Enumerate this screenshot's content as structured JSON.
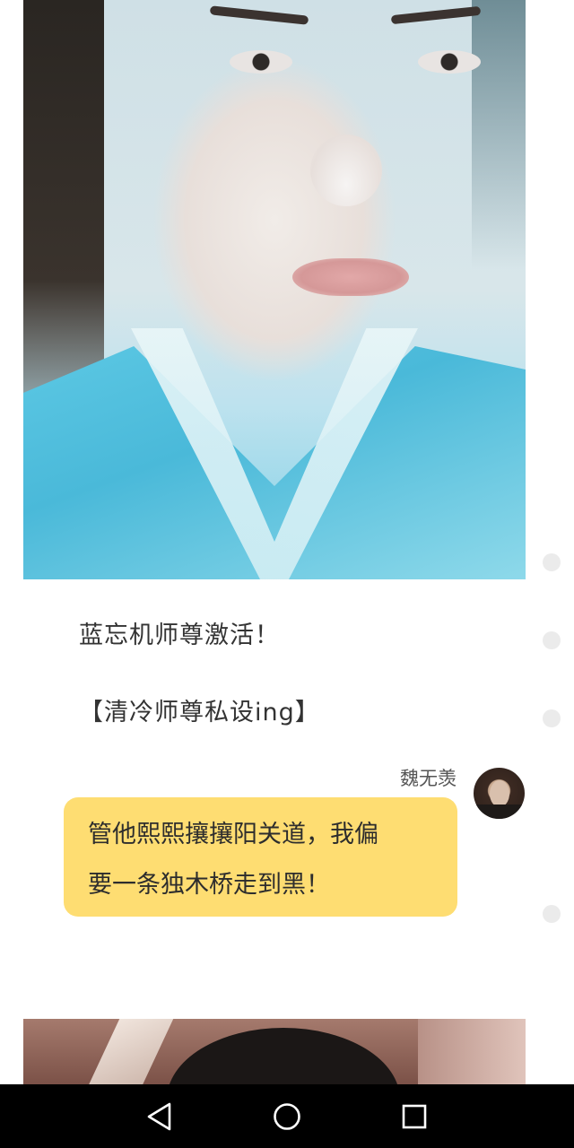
{
  "post": {
    "line1": "蓝忘机师尊激活！",
    "line2": "【清冷师尊私设ing】"
  },
  "chat": {
    "sender_name": "魏无羡",
    "message_line1": "管他熙熙攘攘阳关道，我偏",
    "message_line2": "要一条独木桥走到黑！",
    "bubble_color": "#fedd72"
  },
  "nav": {
    "back_icon": "back-triangle-icon",
    "home_icon": "home-circle-icon",
    "recents_icon": "recents-square-icon"
  }
}
